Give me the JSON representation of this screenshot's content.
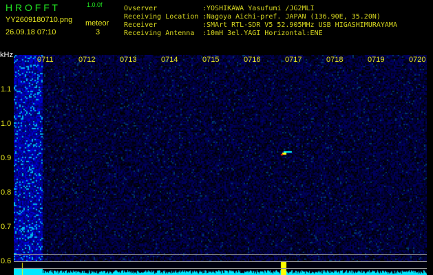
{
  "header": {
    "app_title": "H R O F F T",
    "version": "1.0.0f",
    "filename": "YY2609180710.png",
    "datetime": "26.09.18 07:10",
    "meteor_label": "meteor",
    "meteor_count": "3"
  },
  "info": [
    {
      "label": "Ovserver",
      "value": ":YOSHIKAWA Yasufumi /JG2MLI"
    },
    {
      "label": "Receiving Location",
      "value": ":Nagoya Aichi-pref. JAPAN (136.90E, 35.20N)"
    },
    {
      "label": "Receiver",
      "value": ":SMArt RTL-SDR V5 52.905MHz USB HIGASHIMURAYAMA"
    },
    {
      "label": "Receiving Antenna",
      "value": ":10mH 3el.YAGI Horizontal:ENE"
    }
  ],
  "axis": {
    "unit": "kHz",
    "y_ticks": [
      "1.1",
      "1.0",
      "0.9",
      "0.8",
      "0.7",
      "0.6"
    ],
    "time_ticks": [
      "0711",
      "0712",
      "0713",
      "0714",
      "0715",
      "0716",
      "0717",
      "0718",
      "0719",
      "0720"
    ]
  },
  "colors": {
    "text_green": "#22e822",
    "text_yellow": "#e8e820",
    "noise": "#1010a0",
    "spectrum": "#00ffff"
  }
}
